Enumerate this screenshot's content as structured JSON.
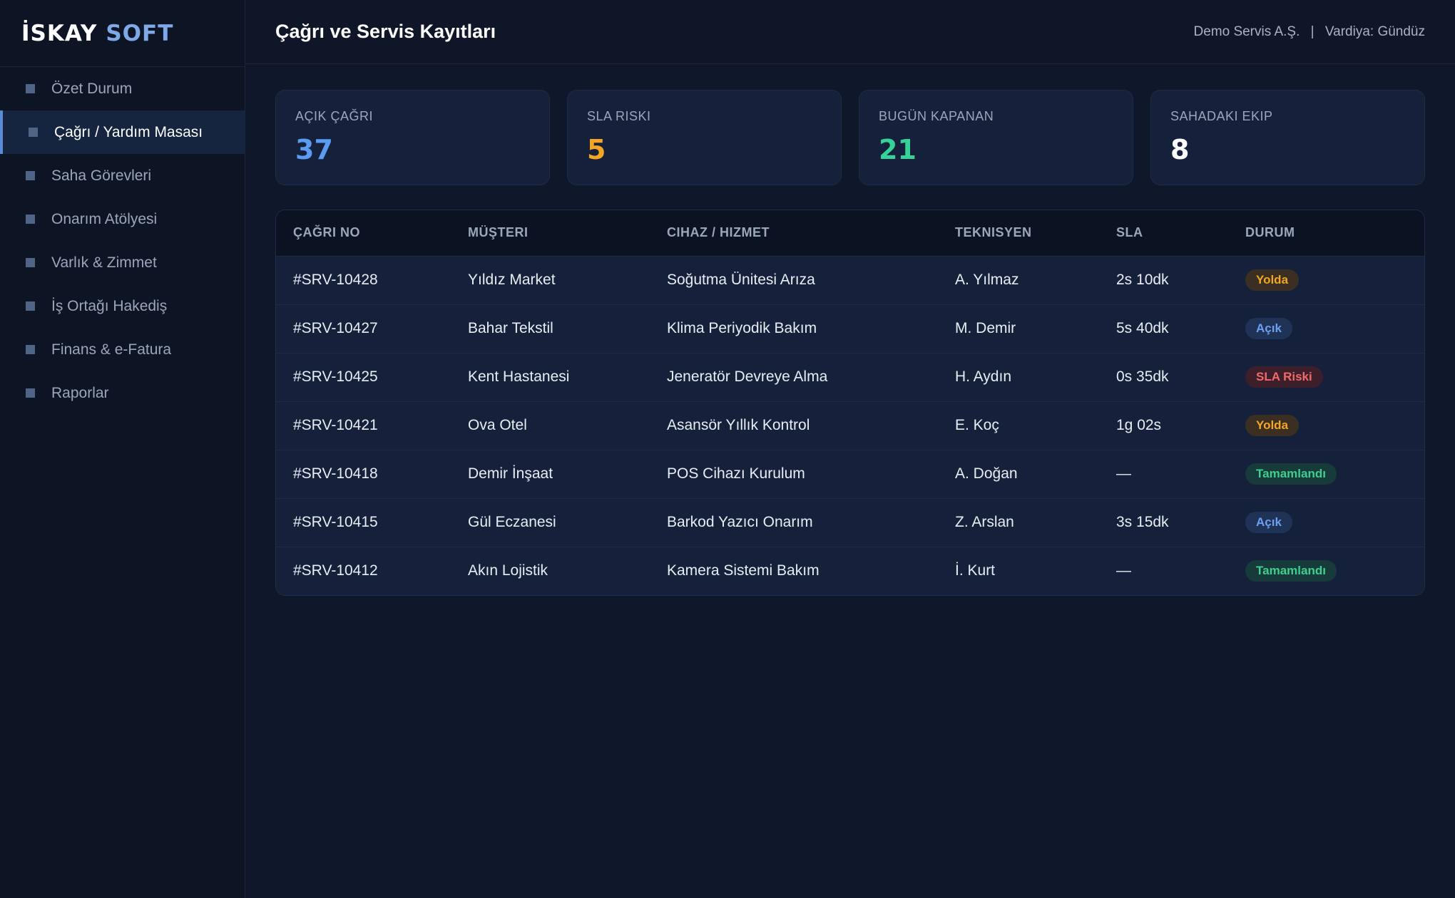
{
  "logo": {
    "part1": "İSKAY",
    "part2": "SOFT"
  },
  "sidebar": {
    "items": [
      {
        "label": "Özet Durum",
        "active": false
      },
      {
        "label": "Çağrı / Yardım Masası",
        "active": true
      },
      {
        "label": "Saha Görevleri",
        "active": false
      },
      {
        "label": "Onarım Atölyesi",
        "active": false
      },
      {
        "label": "Varlık & Zimmet",
        "active": false
      },
      {
        "label": "İş Ortağı Hakediş",
        "active": false
      },
      {
        "label": "Finans & e-Fatura",
        "active": false
      },
      {
        "label": "Raporlar",
        "active": false
      }
    ]
  },
  "header": {
    "title": "Çağrı ve Servis Kayıtları",
    "company": "Demo Servis A.Ş.",
    "separator": "|",
    "shift": "Vardiya: Gündüz"
  },
  "cards": [
    {
      "label": "AÇIK ÇAĞRI",
      "value": "37",
      "color": "#5b9cf2"
    },
    {
      "label": "SLA RISKI",
      "value": "5",
      "color": "#f5a524"
    },
    {
      "label": "BUGÜN KAPANAN",
      "value": "21",
      "color": "#34d399"
    },
    {
      "label": "SAHADAKI EKIP",
      "value": "8",
      "color": "#ffffff"
    }
  ],
  "table": {
    "columns": [
      "ÇAĞRI NO",
      "MÜŞTERI",
      "CIHAZ / HIZMET",
      "TEKNISYEN",
      "SLA",
      "DURUM"
    ],
    "rows": [
      {
        "id": "#SRV-10428",
        "customer": "Yıldız Market",
        "service": "Soğutma Ünitesi Arıza",
        "tech": "A. Yılmaz",
        "sla": "2s 10dk",
        "status": "Yolda",
        "status_class": "b-yolda"
      },
      {
        "id": "#SRV-10427",
        "customer": "Bahar Tekstil",
        "service": "Klima Periyodik Bakım",
        "tech": "M. Demir",
        "sla": "5s 40dk",
        "status": "Açık",
        "status_class": "b-acik"
      },
      {
        "id": "#SRV-10425",
        "customer": "Kent Hastanesi",
        "service": "Jeneratör Devreye Alma",
        "tech": "H. Aydın",
        "sla": "0s 35dk",
        "status": "SLA Riski",
        "status_class": "b-sla"
      },
      {
        "id": "#SRV-10421",
        "customer": "Ova Otel",
        "service": "Asansör Yıllık Kontrol",
        "tech": "E. Koç",
        "sla": "1g 02s",
        "status": "Yolda",
        "status_class": "b-yolda"
      },
      {
        "id": "#SRV-10418",
        "customer": "Demir İnşaat",
        "service": "POS Cihazı Kurulum",
        "tech": "A. Doğan",
        "sla": "—",
        "status": "Tamamlandı",
        "status_class": "b-tamam"
      },
      {
        "id": "#SRV-10415",
        "customer": "Gül Eczanesi",
        "service": "Barkod Yazıcı Onarım",
        "tech": "Z. Arslan",
        "sla": "3s 15dk",
        "status": "Açık",
        "status_class": "b-acik"
      },
      {
        "id": "#SRV-10412",
        "customer": "Akın Lojistik",
        "service": "Kamera Sistemi Bakım",
        "tech": "İ. Kurt",
        "sla": "—",
        "status": "Tamamlandı",
        "status_class": "b-tamam"
      }
    ]
  }
}
